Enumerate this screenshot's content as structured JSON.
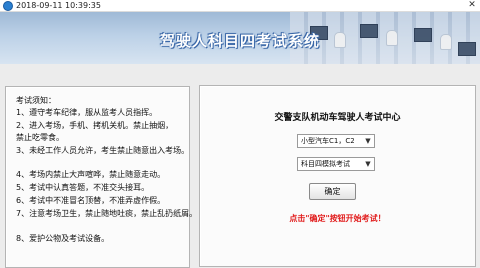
{
  "window": {
    "title": "2018-09-11 10:39:35",
    "close_glyph": "✕",
    "icons": {
      "app": "app-icon",
      "close": "close-icon"
    }
  },
  "banner": {
    "title": "驾驶人科目四考试系统"
  },
  "notice": {
    "title": "考试须知：",
    "items": [
      "1、遵守考车纪律，服从监考人员指挥。",
      "2、进入考场，手机、拷机关机。禁止抽烟，",
      "禁止吃零食。",
      "3、未经工作人员允许，考生禁止随意出入考场。",
      "4、考场内禁止大声喧哗，禁止随意走动。",
      "5、考试中认真答题，不准交头接耳。",
      "6、考试中不准冒名顶替，不准弄虚作假。",
      "7、注意考场卫生，禁止随地吐痰，禁止乱扔纸屑。",
      "8、爱护公物及考试设备。"
    ]
  },
  "login": {
    "heading": "交警支队机动车驾驶人考试中心",
    "vehicle_select": {
      "value": "小型汽车C1，C2",
      "chevron": "▼"
    },
    "subject_select": {
      "value": "科目四模拟考试",
      "chevron": "▼"
    },
    "confirm_label": "确定",
    "hint": "点击\"确定\"按钮开始考试！"
  },
  "colors": {
    "banner_title": "#ffffff",
    "hint": "#e11b1b",
    "panel_border": "#b4b4b4"
  }
}
